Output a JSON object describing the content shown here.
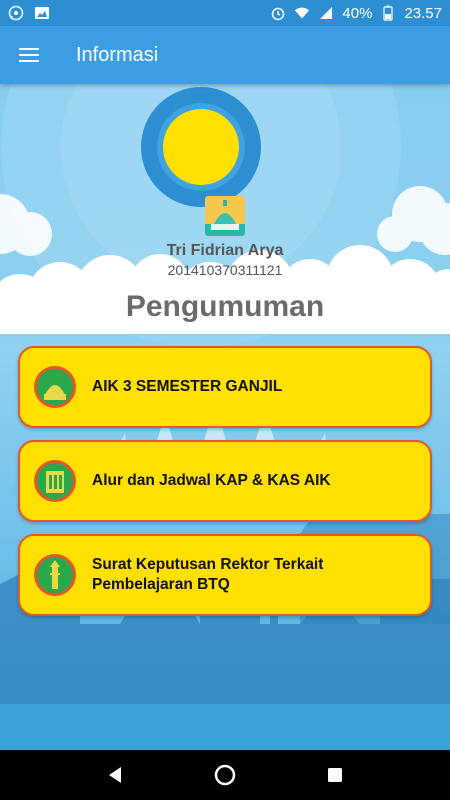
{
  "status_bar": {
    "left_icons": [
      "whatsapp-icon",
      "image-icon"
    ],
    "battery": "40%",
    "time": "23.57"
  },
  "app_bar": {
    "title": "Informasi"
  },
  "profile": {
    "name": "Tri Fidrian Arya",
    "id": "201410370311121"
  },
  "section_title": "Pengumuman",
  "announcements": [
    {
      "label": "AIK 3 SEMESTER GANJIL",
      "icon": "mosque-icon"
    },
    {
      "label": "Alur dan Jadwal KAP & KAS AIK",
      "icon": "building-icon"
    },
    {
      "label": "Surat Keputusan Rektor Terkait Pembelajaran BTQ",
      "icon": "minaret-icon"
    }
  ],
  "colors": {
    "status_bar": "#2d8fd2",
    "app_bar": "#3d9de3",
    "card_bg": "#ffe000",
    "card_border": "#e8552a",
    "title_text": "#6b6b6b"
  }
}
